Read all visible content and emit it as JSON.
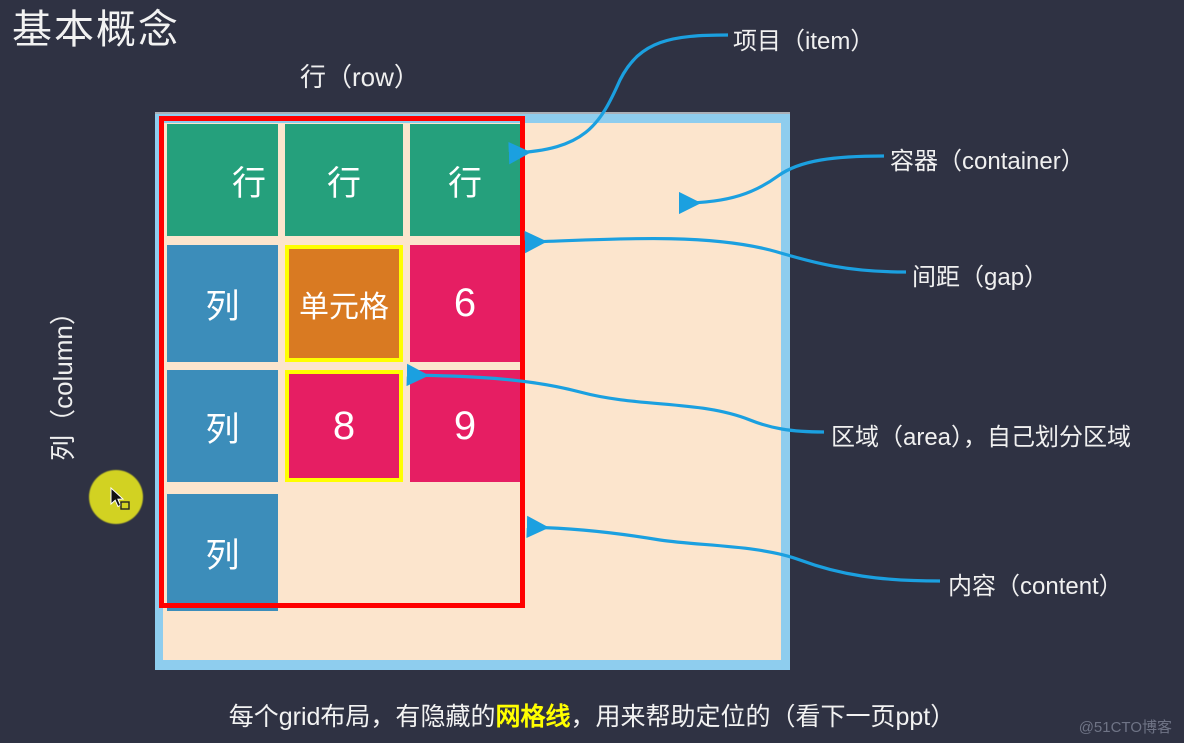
{
  "slide": {
    "title": "基本概念",
    "row_axis_label": "行（row）",
    "column_axis_label": "列（column）",
    "caption_part1": "每个grid布局，有隐藏的",
    "caption_highlight": "网格线",
    "caption_part2": "，用来帮助定位的（看下一页ppt）",
    "watermark": "@51CTO博客",
    "background_color": "#2f3243"
  },
  "container": {
    "frame_color": "#8ecdee",
    "content_color": "#fce5cd",
    "gridline_color": "#ff0000",
    "highlight_color": "#ffff00"
  },
  "cells": [
    {
      "label": "列",
      "color": "#3c8dba",
      "kind": "column-marker"
    },
    {
      "label": "行",
      "color": "#25a07c",
      "kind": "row-item"
    },
    {
      "label": "行",
      "color": "#25a07c",
      "kind": "row-item"
    },
    {
      "label": "行",
      "color": "#25a07c",
      "kind": "row-item"
    },
    {
      "label": "列",
      "color": "#3c8dba",
      "kind": "column-marker"
    },
    {
      "label": "单元格",
      "color": "#d97a22",
      "kind": "cell-highlight"
    },
    {
      "label": "6",
      "color": "#e61e63",
      "kind": "item"
    },
    {
      "label": "列",
      "color": "#3c8dba",
      "kind": "column-marker"
    },
    {
      "label": "8",
      "color": "#e61e63",
      "kind": "area-highlight"
    },
    {
      "label": "9",
      "color": "#e61e63",
      "kind": "item"
    },
    {
      "label": "列",
      "color": "#3c8dba",
      "kind": "column-marker"
    }
  ],
  "annotations": [
    {
      "id": "item",
      "label": "项目（item）"
    },
    {
      "id": "container",
      "label": "容器（container）"
    },
    {
      "id": "gap",
      "label": "间距（gap）"
    },
    {
      "id": "area",
      "label": "区域（area），自己划分区域"
    },
    {
      "id": "content",
      "label": "内容（content）"
    }
  ],
  "leader_color": "#1ba0e0"
}
